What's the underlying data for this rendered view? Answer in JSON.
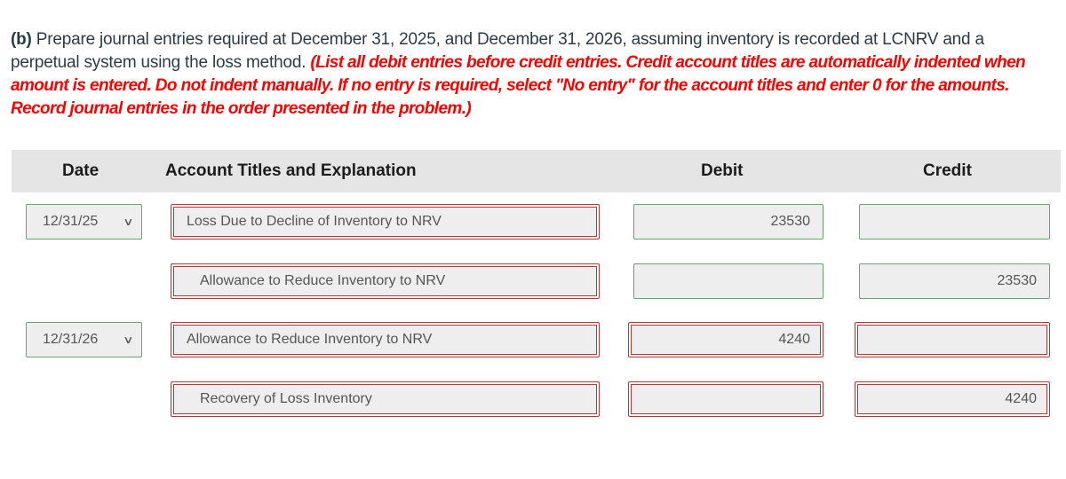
{
  "question": {
    "lead": "(b)",
    "text": " Prepare journal entries required at December 31, 2025, and December 31, 2026, assuming inventory is recorded at LCNRV and a perpetual system using the loss method. ",
    "instructions": "(List all debit entries before credit entries. Credit account titles are automatically indented when amount is entered. Do not indent manually. If no entry is required, select \"No entry\" for the account titles and enter 0 for the amounts. Record journal entries in the order presented in the problem.)"
  },
  "table": {
    "headers": {
      "date": "Date",
      "account": "Account Titles and Explanation",
      "debit": "Debit",
      "credit": "Credit"
    },
    "rows": [
      {
        "date": "12/31/25",
        "account": "Loss Due to Decline of Inventory to NRV",
        "debit": "23530",
        "credit": ""
      },
      {
        "date": "",
        "account": "Allowance to Reduce Inventory to NRV",
        "debit": "",
        "credit": "23530"
      },
      {
        "date": "12/31/26",
        "account": "Allowance to Reduce Inventory to NRV",
        "debit": "4240",
        "credit": ""
      },
      {
        "date": "",
        "account": "Recovery of Loss Inventory",
        "debit": "",
        "credit": "4240"
      }
    ]
  },
  "icons": {
    "dropdown": "chevron-down-icon"
  },
  "colors": {
    "instruction_red": "#ff0000",
    "correct_border": "#6aa56f",
    "incorrect_border": "#b33a3a",
    "header_bg": "#e5e5e5"
  }
}
